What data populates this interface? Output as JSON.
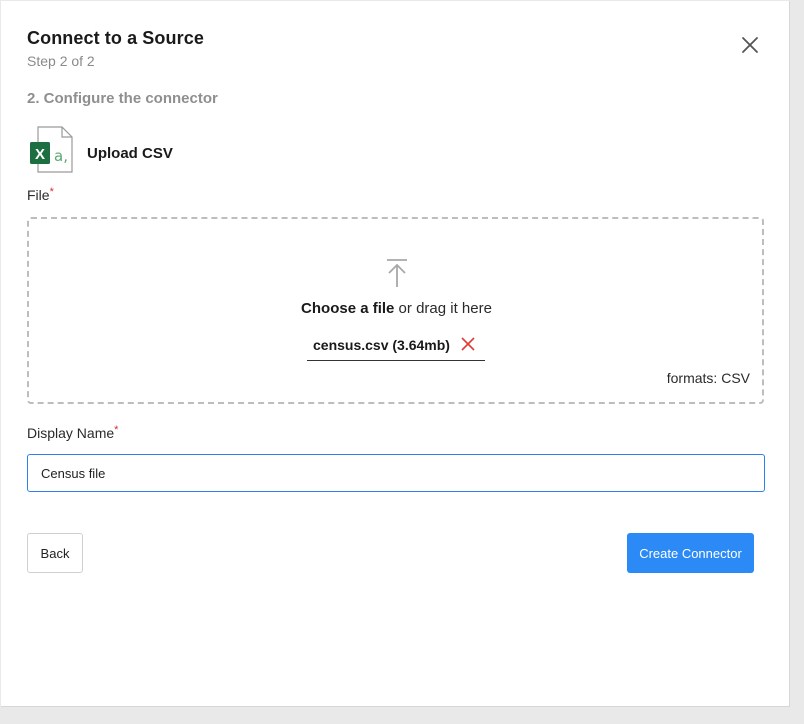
{
  "dialog": {
    "title": "Connect to a Source",
    "step": "Step 2 of 2",
    "close_icon": "close-icon"
  },
  "section": {
    "heading": "2. Configure the connector"
  },
  "connector": {
    "icon": "excel-csv-file-icon",
    "icon_letter": "X",
    "icon_glyph": "a,",
    "name": "Upload CSV",
    "brand_color": "#1d6f42"
  },
  "file_field": {
    "label": "File",
    "required_mark": "*",
    "upload_icon": "upload-arrow-icon",
    "choose_text": "Choose a file",
    "drag_text": " or drag it here",
    "selected_file": "census.csv (3.64mb)",
    "remove_icon": "remove-x-icon",
    "formats": "formats: CSV"
  },
  "display_name_field": {
    "label": "Display Name",
    "required_mark": "*",
    "value": "Census file"
  },
  "actions": {
    "back_label": "Back",
    "create_label": "Create Connector"
  },
  "colors": {
    "accent": "#2b8af5",
    "required": "#d32f2f",
    "remove": "#e53935",
    "input_focus": "#2f80ed"
  }
}
